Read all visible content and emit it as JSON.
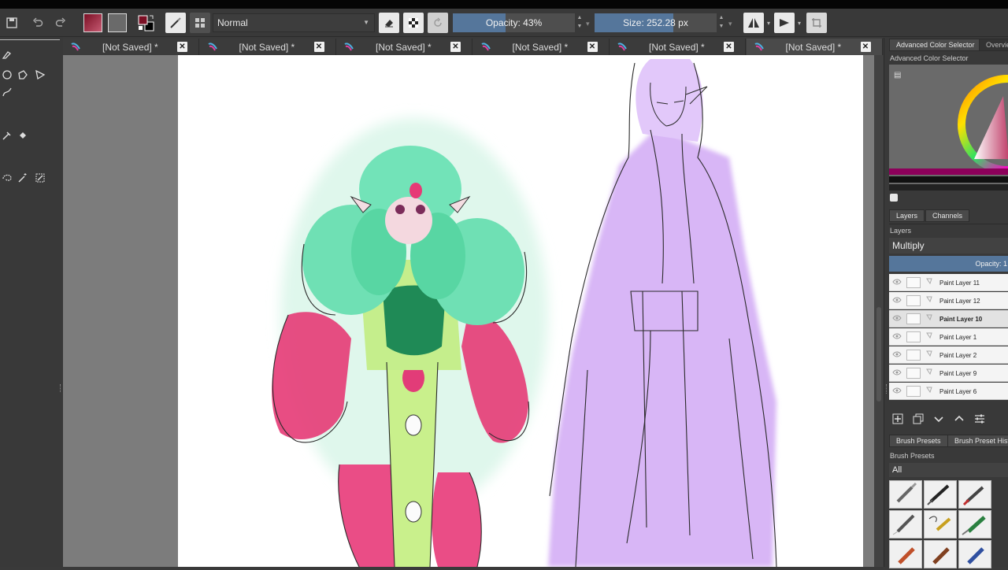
{
  "window": {
    "title": "[Not Saved]"
  },
  "toolbar": {
    "blend_mode": "Normal",
    "opacity_label": "Opacity: 43%",
    "opacity_value": 0.43,
    "size_label": "Size: 252.28 px",
    "icons": [
      "save-icon",
      "undo-icon",
      "redo-icon",
      "gradient-icon",
      "pattern-icon",
      "color-swap-icon",
      "brush-tool-icon",
      "preset-grid-icon",
      "eraser-icon",
      "alpha-lock-icon",
      "reload-icon",
      "mirror-horizontal-icon",
      "mirror-vertical-icon",
      "wrap-icon"
    ]
  },
  "tabs": [
    {
      "label": "[Not Saved]",
      "modified": "*"
    },
    {
      "label": "[Not Saved]",
      "modified": "*"
    },
    {
      "label": "[Not Saved]",
      "modified": "*"
    },
    {
      "label": "[Not Saved]",
      "modified": "*"
    },
    {
      "label": "[Not Saved]",
      "modified": "*"
    },
    {
      "label": "[Not Saved]",
      "modified": "*"
    }
  ],
  "color_panel": {
    "tabs": [
      "Advanced Color Selector",
      "Overview"
    ],
    "title": "Advanced Color Selector"
  },
  "layers_panel": {
    "tabs": [
      "Layers",
      "Channels"
    ],
    "title": "Layers",
    "blend_mode": "Multiply",
    "opacity_label": "Opacity: 1",
    "layers": [
      {
        "name": "Paint Layer 11",
        "selected": false
      },
      {
        "name": "Paint Layer 12",
        "selected": false
      },
      {
        "name": "Paint Layer 10",
        "selected": true
      },
      {
        "name": "Paint Layer 1",
        "selected": false
      },
      {
        "name": "Paint Layer 2",
        "selected": false
      },
      {
        "name": "Paint Layer 9",
        "selected": false
      },
      {
        "name": "Paint Layer 6",
        "selected": false
      }
    ]
  },
  "brush_panel": {
    "tabs": [
      "Brush Presets",
      "Brush Preset Histo"
    ],
    "title": "Brush Presets",
    "filter": "All"
  },
  "colors": {
    "foreground": "#7a0f24",
    "accent": "#55769b",
    "canvas_bg": "#7c7c7c",
    "paint_pink": "#e5356e",
    "paint_mint": "#4fd3a8",
    "paint_lime": "#c8f08a",
    "paint_lavender": "#d9b8f7"
  }
}
